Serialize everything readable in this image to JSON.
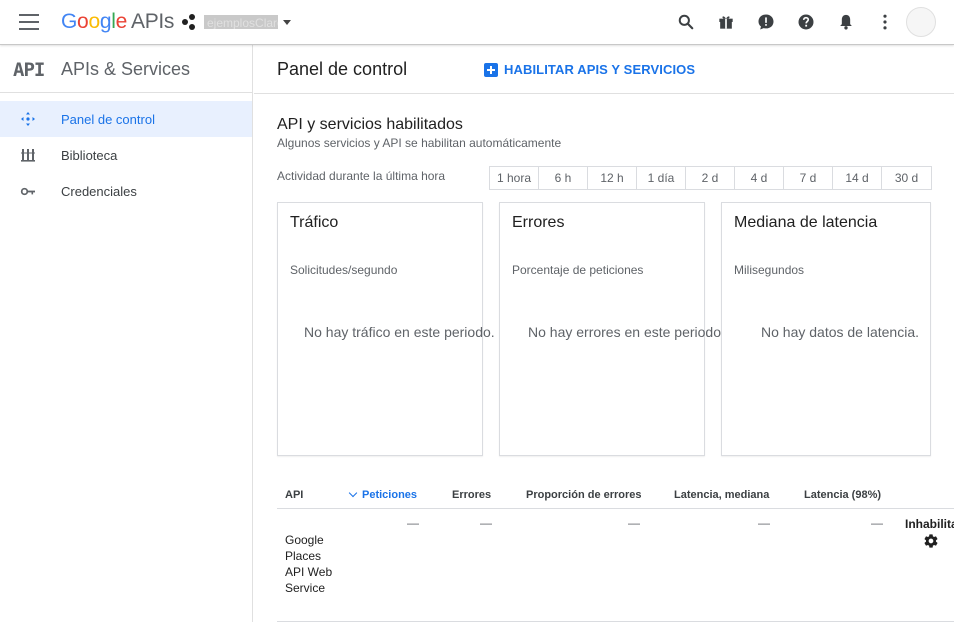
{
  "header": {
    "logo": {
      "g1": "G",
      "o1": "o",
      "o2": "o",
      "g2": "g",
      "l": "l",
      "e": "e",
      "apis": "APIs"
    },
    "project_name": "ejemplosClaros",
    "icons": [
      "search-icon",
      "gift-icon",
      "alert-icon",
      "help-icon",
      "notifications-icon",
      "more-vert-icon"
    ]
  },
  "sidebar": {
    "badge": "API",
    "title": "APIs & Services",
    "items": [
      {
        "label": "Panel de control",
        "icon": "dashboard-icon",
        "active": true
      },
      {
        "label": "Biblioteca",
        "icon": "library-icon",
        "active": false
      },
      {
        "label": "Credenciales",
        "icon": "key-icon",
        "active": false
      }
    ]
  },
  "main": {
    "title": "Panel de control",
    "enable_button": "HABILITAR APIS Y SERVICIOS",
    "section_title": "API y servicios habilitados",
    "section_subtitle": "Algunos servicios y API se habilitan automáticamente",
    "activity_label": "Actividad durante la última hora",
    "ranges": [
      "1 hora",
      "6 h",
      "12 h",
      "1 día",
      "2 d",
      "4 d",
      "7 d",
      "14 d",
      "30 d"
    ],
    "cards": [
      {
        "title": "Tráfico",
        "subtitle": "Solicitudes/segundo",
        "empty": "No hay tráfico en este periodo."
      },
      {
        "title": "Errores",
        "subtitle": "Porcentaje de peticiones",
        "empty": "No hay errores en este periodo."
      },
      {
        "title": "Mediana de latencia",
        "subtitle": "Milisegundos",
        "empty": "No hay datos de latencia."
      }
    ],
    "table": {
      "headers": {
        "api": "API",
        "requests": "Peticiones",
        "errors": "Errores",
        "error_ratio": "Proporción de errores",
        "latency_median": "Latencia, mediana",
        "latency_98": "Latencia (98%)"
      },
      "rows": [
        {
          "api": "Google Places API Web Service",
          "requests": "—",
          "errors": "—",
          "error_ratio": "—",
          "latency_median": "—",
          "latency_98": "—",
          "status": "Inhabilitar"
        }
      ]
    }
  },
  "colors": {
    "accent": "#1a73e8",
    "active_bg": "#e8f0fe",
    "border": "#dadce0"
  }
}
